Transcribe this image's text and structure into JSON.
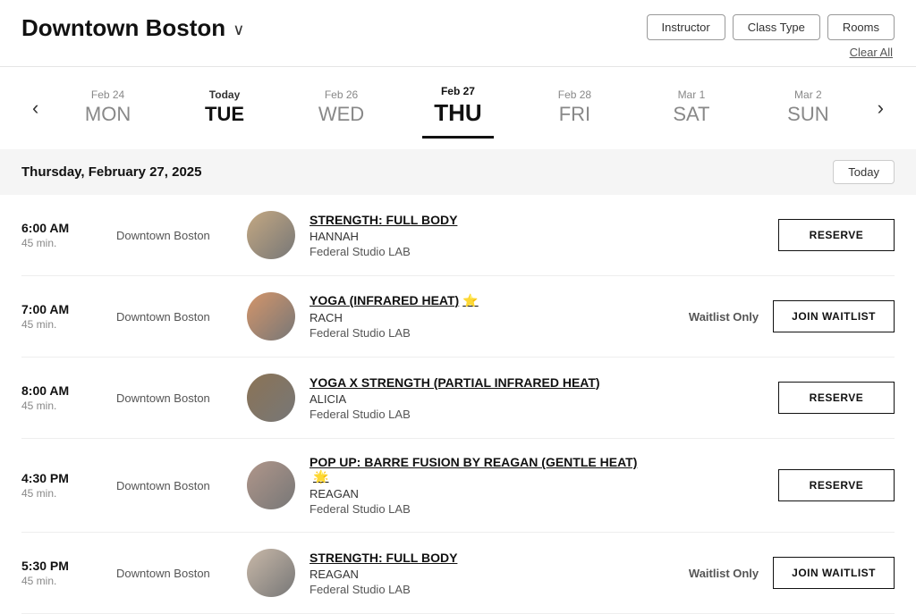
{
  "header": {
    "title": "Downtown Boston",
    "chevron": "∨",
    "filters": [
      {
        "id": "instructor",
        "label": "Instructor"
      },
      {
        "id": "class-type",
        "label": "Class Type"
      },
      {
        "id": "rooms",
        "label": "Rooms"
      }
    ],
    "clear_all_label": "Clear All"
  },
  "day_nav": {
    "prev_arrow": "‹",
    "next_arrow": "›",
    "days": [
      {
        "id": "mon",
        "date": "Feb 24",
        "name": "MON",
        "state": "normal"
      },
      {
        "id": "tue",
        "date": "Today",
        "name": "TUE",
        "state": "today"
      },
      {
        "id": "wed",
        "date": "Feb 26",
        "name": "WED",
        "state": "normal"
      },
      {
        "id": "thu",
        "date": "Feb 27",
        "name": "THU",
        "state": "selected"
      },
      {
        "id": "fri",
        "date": "Feb 28",
        "name": "FRI",
        "state": "normal"
      },
      {
        "id": "sat",
        "date": "Mar 1",
        "name": "SAT",
        "state": "normal"
      },
      {
        "id": "sun",
        "date": "Mar 2",
        "name": "SUN",
        "state": "normal"
      }
    ]
  },
  "schedule": {
    "date_label": "Thursday, February 27, 2025",
    "today_button": "Today",
    "classes": [
      {
        "id": "class-1",
        "time": "6:00 AM",
        "duration": "45 min.",
        "location": "Downtown Boston",
        "name": "STRENGTH: FULL BODY",
        "instructor": "HANNAH",
        "studio": "Federal Studio LAB",
        "status": "",
        "action": "RESERVE",
        "action_type": "reserve",
        "emoji": ""
      },
      {
        "id": "class-2",
        "time": "7:00 AM",
        "duration": "45 min.",
        "location": "Downtown Boston",
        "name": "YOGA (INFRARED HEAT)",
        "instructor": "RACH",
        "studio": "Federal Studio LAB",
        "status": "Waitlist Only",
        "action": "JOIN WAITLIST",
        "action_type": "waitlist",
        "emoji": "⭐"
      },
      {
        "id": "class-3",
        "time": "8:00 AM",
        "duration": "45 min.",
        "location": "Downtown Boston",
        "name": "YOGA X STRENGTH (PARTIAL INFRARED HEAT)",
        "instructor": "ALICIA",
        "studio": "Federal Studio LAB",
        "status": "",
        "action": "RESERVE",
        "action_type": "reserve",
        "emoji": ""
      },
      {
        "id": "class-4",
        "time": "4:30 PM",
        "duration": "45 min.",
        "location": "Downtown Boston",
        "name": "POP UP: BARRE FUSION BY REAGAN (GENTLE HEAT)",
        "instructor": "REAGAN",
        "studio": "Federal Studio LAB",
        "status": "",
        "action": "RESERVE",
        "action_type": "reserve",
        "emoji": "🌟"
      },
      {
        "id": "class-5",
        "time": "5:30 PM",
        "duration": "45 min.",
        "location": "Downtown Boston",
        "name": "STRENGTH: FULL BODY",
        "instructor": "REAGAN",
        "studio": "Federal Studio LAB",
        "status": "Waitlist Only",
        "action": "JOIN WAITLIST",
        "action_type": "waitlist",
        "emoji": ""
      }
    ]
  },
  "avatar_colors": [
    "#c9a88a",
    "#d4a574",
    "#8b7355",
    "#b8a090",
    "#c5b5a0"
  ]
}
